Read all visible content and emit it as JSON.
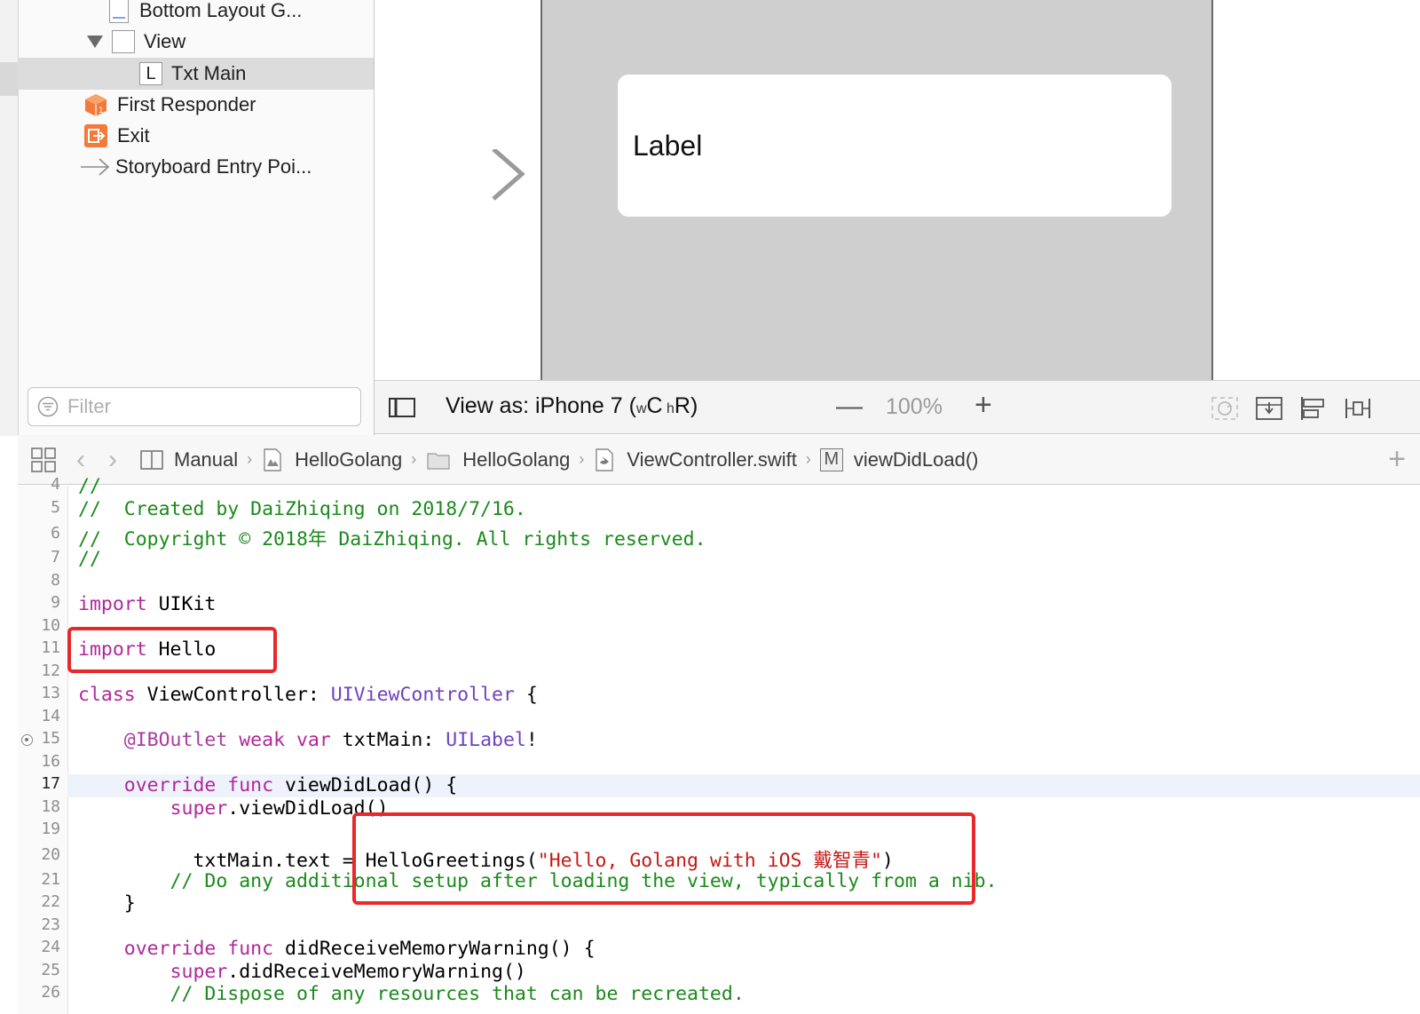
{
  "outline": {
    "items": [
      {
        "label": "Bottom Layout G...",
        "icon": "layout-guide-icon"
      },
      {
        "label": "View",
        "icon": "view-icon",
        "expanded": true
      },
      {
        "label": "Txt Main",
        "icon": "label-icon",
        "glyph": "L",
        "selected": true
      },
      {
        "label": "First Responder",
        "icon": "first-responder-icon"
      },
      {
        "label": "Exit",
        "icon": "exit-icon"
      },
      {
        "label": "Storyboard Entry Poi...",
        "icon": "entry-point-icon"
      }
    ],
    "filter_placeholder": "Filter"
  },
  "canvas": {
    "label_text": "Label",
    "device_color": "#cfcfcf"
  },
  "canvas_bar": {
    "view_as_prefix": "View as: iPhone 7 (",
    "size_w": "w",
    "size_c": "C",
    "size_h": " h",
    "size_r": "R",
    "view_as_suffix": ")",
    "zoom_minus": "—",
    "zoom": "100%",
    "zoom_plus": "+"
  },
  "jumpbar": {
    "back": "‹",
    "forward": "›",
    "crumbs": [
      "Manual",
      "HelloGolang",
      "HelloGolang",
      "ViewController.swift",
      "viewDidLoad()"
    ],
    "method_glyph": "M",
    "add": "+"
  },
  "editor": {
    "current_line": 17,
    "line_numbers": [
      "4",
      "5",
      "6",
      "7",
      "8",
      "9",
      "10",
      "11",
      "12",
      "13",
      "14",
      "15",
      "16",
      "17",
      "18",
      "19",
      "20",
      "21",
      "22",
      "23",
      "24",
      "25",
      "26"
    ],
    "line4": "//",
    "line5": "//  Created by DaiZhiqing on 2018/7/16.",
    "line6": "//  Copyright © 2018年 DaiZhiqing. All rights reserved.",
    "line7": "//",
    "kw_import": "import",
    "uikit": " UIKit",
    "hello": " Hello",
    "kw_class": "class",
    "vc_decl": " ViewController: ",
    "uivc": "UIViewController",
    "brace_open": " {",
    "indent4": "    ",
    "indent8": "        ",
    "indent10": "          ",
    "iboutlet": "@IBOutlet",
    "sp": " ",
    "kw_weak": "weak",
    "kw_var": "var",
    "txtmain_decl": " txtMain: ",
    "uilabel": "UILabel",
    "bang": "!",
    "kw_override": "override",
    "kw_func": "func",
    "viewdidload_decl": " viewDidLoad() {",
    "kw_super": "super",
    "super_vdl": ".viewDidLoad()",
    "assign": "txtMain.text = HelloGreetings(",
    "greeting": "\"Hello, Golang with iOS 戴智青\"",
    "close_paren": ")",
    "line21": "// Do any additional setup after loading the view, typically from a nib.",
    "brace_close": "}",
    "didreceive_decl": " didReceiveMemoryWarning() {",
    "super_drmw": ".didReceiveMemoryWarning()",
    "line26": "// Dispose of any resources that can be recreated."
  },
  "colors": {
    "comment": "#1a8a1a",
    "keyword": "#b0289a",
    "type": "#6f42c1",
    "string": "#c41a16",
    "highlight_box": "#e8282b"
  }
}
